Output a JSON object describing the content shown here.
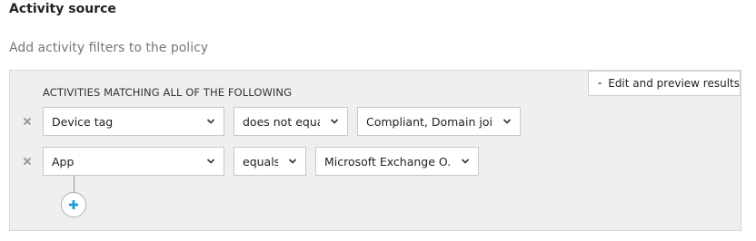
{
  "section": {
    "title": "Activity source",
    "subtitle": "Add activity filters to the policy"
  },
  "panel": {
    "heading": "ACTIVITIES MATCHING ALL OF THE FOLLOWING",
    "edit_preview_label": "Edit and preview results",
    "add_icon": "plus-icon",
    "rows": [
      {
        "field": "Device tag",
        "operator": "does not equal",
        "value": "Compliant, Domain joi..."
      },
      {
        "field": "App",
        "operator": "equals",
        "value": "Microsoft Exchange O..."
      }
    ]
  },
  "colors": {
    "panel_bg": "#efefef",
    "add_plus": "#1a9ad6",
    "remove_x": "#9a9a9a"
  }
}
